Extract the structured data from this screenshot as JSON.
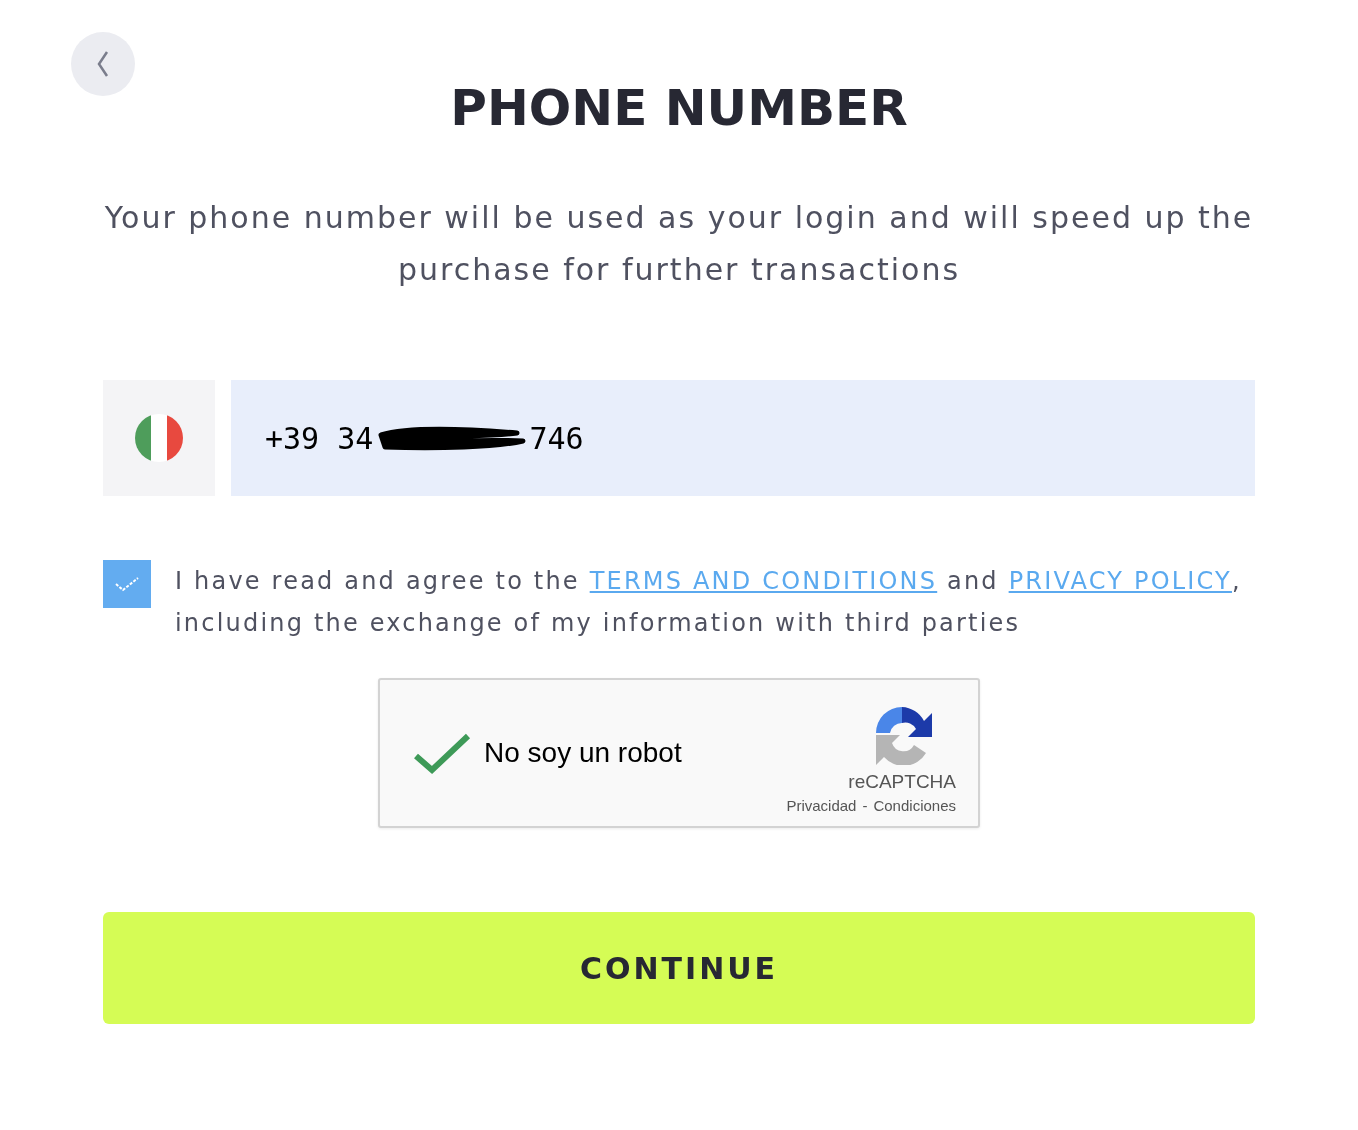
{
  "back_button": {
    "kind": "back"
  },
  "title": "PHONE NUMBER",
  "subtitle": "Your phone number will be used as your login and will speed up the purchase for further transactions",
  "phone": {
    "value_start": "+39 34",
    "value_end": "746",
    "redacted": true
  },
  "consent": {
    "checked": true,
    "segments": [
      {
        "kind": "text",
        "text": "I have read and agree to the "
      },
      {
        "kind": "link",
        "text": "TERMS AND CONDITIONS"
      },
      {
        "kind": "text",
        "text": " and "
      },
      {
        "kind": "link",
        "text": "PRIVACY POLICY"
      },
      {
        "kind": "text",
        "text": ", including the exchange of my information with third parties"
      }
    ]
  },
  "captcha": {
    "checked": true,
    "label": "No soy un robot",
    "brand": "reCAPTCHA",
    "links": [
      "Privacidad",
      "Condiciones"
    ],
    "separator": "-"
  },
  "continue_button": "CONTINUE"
}
